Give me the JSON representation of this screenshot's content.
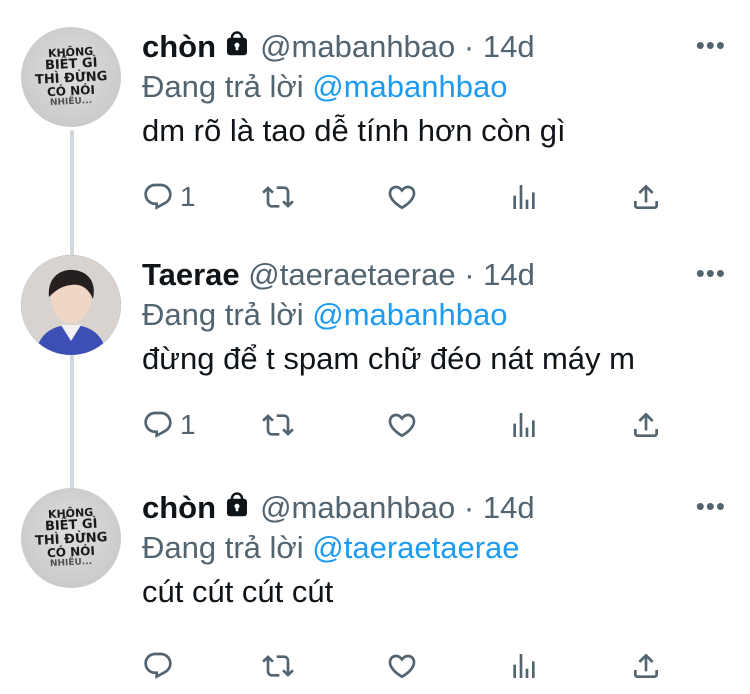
{
  "tweets": [
    {
      "name": "chòn",
      "handle": "@mabanhbao",
      "separator": "·",
      "time": "14d",
      "reply_prefix": "Đang trả lời",
      "reply_to": "@mabanhbao",
      "text": "dm rõ là tao dễ tính hơn còn gì",
      "reply_count": "1",
      "avatar_lines": [
        "KHÔNG",
        "BIẾT GÌ",
        "THÌ ĐỪNG",
        "CÓ NÓI",
        "NHIỀU..."
      ]
    },
    {
      "name": "Taerae",
      "handle": "@taeraetaerae",
      "separator": "·",
      "time": "14d",
      "reply_prefix": "Đang trả lời",
      "reply_to": "@mabanhbao",
      "text": "đừng để t spam chữ đéo nát máy m",
      "reply_count": "1"
    },
    {
      "name": "chòn",
      "handle": "@mabanhbao",
      "separator": "·",
      "time": "14d",
      "reply_prefix": "Đang trả lời",
      "reply_to": "@taeraetaerae",
      "text": "cút cút cút cút",
      "reply_count": "",
      "avatar_lines": [
        "KHÔNG",
        "BIẾT GÌ",
        "THÌ ĐỪNG",
        "CÓ NÓI",
        "NHIỀU..."
      ]
    }
  ],
  "icons": {
    "more": "more-horizontal-icon",
    "reply": "reply-icon",
    "retweet": "retweet-icon",
    "like": "heart-icon",
    "views": "analytics-icon",
    "share": "share-icon",
    "lock": "lock-icon"
  },
  "colors": {
    "link": "#1d9bf0",
    "secondary": "#536471",
    "primary": "#0f1419",
    "thread_line": "#cfd9de"
  }
}
